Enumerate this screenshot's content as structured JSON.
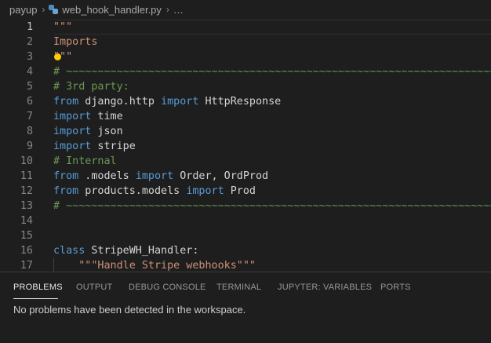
{
  "breadcrumb": {
    "folder": "payup",
    "file": "web_hook_handler.py",
    "more": "…"
  },
  "editor": {
    "current_line": 1,
    "lines": [
      {
        "n": "1",
        "tokens": [
          {
            "c": "str",
            "t": "\"\"\""
          }
        ]
      },
      {
        "n": "2",
        "tokens": [
          {
            "c": "str",
            "t": "Imports"
          }
        ]
      },
      {
        "n": "3",
        "tokens": [
          {
            "c": "str",
            "t": "\"\"\""
          }
        ]
      },
      {
        "n": "4",
        "tokens": [
          {
            "c": "com",
            "t": "# ~~~~~~~~~~~~~~~~~~~~~~~~~~~~~~~~~~~~~~~~~~~~~~~~~~~~~~~~~~~~~~~~~~~~~~~~~~~~~~~~~~~~"
          }
        ]
      },
      {
        "n": "5",
        "tokens": [
          {
            "c": "com",
            "t": "# 3rd party:"
          }
        ]
      },
      {
        "n": "6",
        "tokens": [
          {
            "c": "kw",
            "t": "from"
          },
          {
            "c": "txt",
            "t": " django.http "
          },
          {
            "c": "kw",
            "t": "import"
          },
          {
            "c": "txt",
            "t": " HttpResponse"
          }
        ]
      },
      {
        "n": "7",
        "tokens": [
          {
            "c": "kw",
            "t": "import"
          },
          {
            "c": "txt",
            "t": " time"
          }
        ]
      },
      {
        "n": "8",
        "tokens": [
          {
            "c": "kw",
            "t": "import"
          },
          {
            "c": "txt",
            "t": " json"
          }
        ]
      },
      {
        "n": "9",
        "tokens": [
          {
            "c": "kw",
            "t": "import"
          },
          {
            "c": "txt",
            "t": " stripe"
          }
        ]
      },
      {
        "n": "10",
        "tokens": [
          {
            "c": "com",
            "t": "# Internal"
          }
        ]
      },
      {
        "n": "11",
        "tokens": [
          {
            "c": "kw",
            "t": "from"
          },
          {
            "c": "txt",
            "t": " .models "
          },
          {
            "c": "kw",
            "t": "import"
          },
          {
            "c": "txt",
            "t": " Order, OrdProd"
          }
        ]
      },
      {
        "n": "12",
        "tokens": [
          {
            "c": "kw",
            "t": "from"
          },
          {
            "c": "txt",
            "t": " products.models "
          },
          {
            "c": "kw",
            "t": "import"
          },
          {
            "c": "txt",
            "t": " Prod"
          }
        ]
      },
      {
        "n": "13",
        "tokens": [
          {
            "c": "com",
            "t": "# ~~~~~~~~~~~~~~~~~~~~~~~~~~~~~~~~~~~~~~~~~~~~~~~~~~~~~~~~~~~~~~~~~~~~~~~~~~~~~~~~~~~~"
          }
        ]
      },
      {
        "n": "14",
        "tokens": []
      },
      {
        "n": "15",
        "tokens": []
      },
      {
        "n": "16",
        "tokens": [
          {
            "c": "kw",
            "t": "class"
          },
          {
            "c": "txt",
            "t": " StripeWH_Handler:"
          }
        ]
      },
      {
        "n": "17",
        "tokens": [
          {
            "c": "txt",
            "t": "    "
          },
          {
            "c": "str",
            "t": "\"\"\"Handle Stripe webhooks\"\"\""
          }
        ],
        "indent_guide": true
      }
    ]
  },
  "panel": {
    "tabs": [
      {
        "id": "problems",
        "label": "PROBLEMS",
        "active": true
      },
      {
        "id": "output",
        "label": "OUTPUT",
        "active": false
      },
      {
        "id": "debug-console",
        "label": "DEBUG CONSOLE",
        "active": false
      },
      {
        "id": "terminal",
        "label": "TERMINAL",
        "active": false
      },
      {
        "id": "jupyter-variables",
        "label": "JUPYTER: VARIABLES",
        "active": false
      },
      {
        "id": "ports",
        "label": "PORTS",
        "active": false
      }
    ],
    "message": "No problems have been detected in the workspace."
  },
  "icons": {
    "file_icon": "python-file-icon",
    "separator": "chevron-right-icon",
    "lightbulb": "lightbulb-icon"
  },
  "colors": {
    "background": "#1e1e1e",
    "keyword": "#569cd6",
    "string": "#ce9178",
    "comment": "#6a9955",
    "text": "#d4d4d4",
    "lightbulb": "#ffcc00"
  }
}
